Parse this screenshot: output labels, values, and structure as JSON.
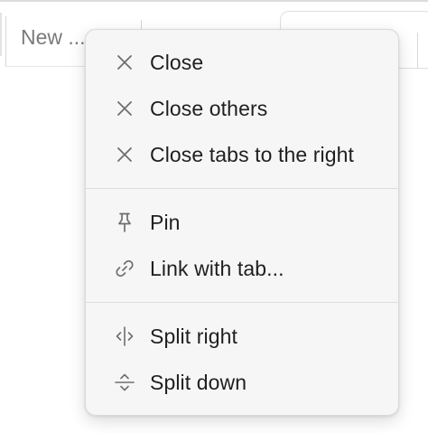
{
  "tab_bar": {
    "new_tab_label": "New ..."
  },
  "context_menu": {
    "groups": [
      {
        "items": [
          {
            "label": "Close",
            "icon": "close-icon"
          },
          {
            "label": "Close others",
            "icon": "close-icon"
          },
          {
            "label": "Close tabs to the right",
            "icon": "close-icon"
          }
        ]
      },
      {
        "items": [
          {
            "label": "Pin",
            "icon": "pin-icon"
          },
          {
            "label": "Link with tab...",
            "icon": "link-icon"
          }
        ]
      },
      {
        "items": [
          {
            "label": "Split right",
            "icon": "split-right-icon"
          },
          {
            "label": "Split down",
            "icon": "split-down-icon"
          }
        ]
      }
    ]
  },
  "colors": {
    "menu_background": "#f6f6f6",
    "menu_border": "#d9d9d9",
    "text": "#1f1f1f",
    "icon": "#6e6e6e",
    "separator": "#dddddd"
  }
}
